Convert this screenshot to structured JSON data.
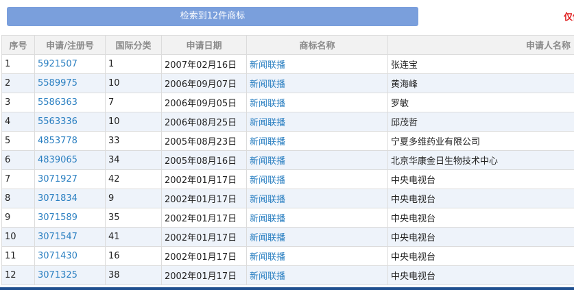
{
  "banner": {
    "text": "检索到12件商标",
    "notice": "仅供"
  },
  "table": {
    "headers": [
      "序号",
      "申请/注册号",
      "国际分类",
      "申请日期",
      "商标名称",
      "申请人名称"
    ],
    "rows": [
      [
        "1",
        "5921507",
        "1",
        "2007年02月16日",
        "新闻联播",
        "张连宝"
      ],
      [
        "2",
        "5589975",
        "10",
        "2006年09月07日",
        "新闻联播",
        "黄海峰"
      ],
      [
        "3",
        "5586363",
        "7",
        "2006年09月05日",
        "新闻联播",
        "罗敏"
      ],
      [
        "4",
        "5563336",
        "10",
        "2006年08月25日",
        "新闻联播",
        "邱茂哲"
      ],
      [
        "5",
        "4853778",
        "33",
        "2005年08月23日",
        "新闻联播",
        "宁夏多维药业有限公司"
      ],
      [
        "6",
        "4839065",
        "34",
        "2005年08月16日",
        "新闻联播",
        "北京华康金日生物技术中心"
      ],
      [
        "7",
        "3071927",
        "42",
        "2002年01月17日",
        "新闻联播",
        "中央电视台"
      ],
      [
        "8",
        "3071834",
        "9",
        "2002年01月17日",
        "新闻联播",
        "中央电视台"
      ],
      [
        "9",
        "3071589",
        "35",
        "2002年01月17日",
        "新闻联播",
        "中央电视台"
      ],
      [
        "10",
        "3071547",
        "41",
        "2002年01月17日",
        "新闻联播",
        "中央电视台"
      ],
      [
        "11",
        "3071430",
        "16",
        "2002年01月17日",
        "新闻联播",
        "中央电视台"
      ],
      [
        "12",
        "3071325",
        "38",
        "2002年01月17日",
        "新闻联播",
        "中央电视台"
      ]
    ]
  },
  "colors": {
    "banner": "#7a9fdc",
    "link": "#2a7fc1",
    "notice": "#e02020",
    "row_alt": "#eef3fa",
    "bottom_bar": "#1f4f8f"
  }
}
